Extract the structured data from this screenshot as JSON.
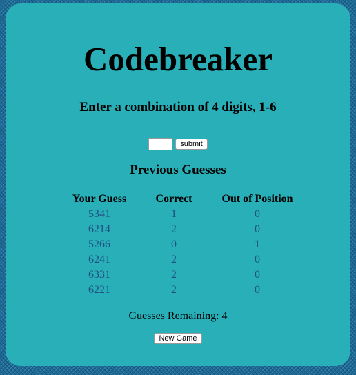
{
  "page": {
    "title": "Codebreaker",
    "instructions": "Enter a combination of 4 digits, 1-6"
  },
  "form": {
    "guess_value": "",
    "submit_label": "submit"
  },
  "history": {
    "heading": "Previous Guesses",
    "columns": [
      "Your Guess",
      "Correct",
      "Out of Position"
    ],
    "rows": [
      [
        "5341",
        "1",
        "0"
      ],
      [
        "6214",
        "2",
        "0"
      ],
      [
        "5266",
        "0",
        "1"
      ],
      [
        "6241",
        "2",
        "0"
      ],
      [
        "6331",
        "2",
        "0"
      ],
      [
        "6221",
        "2",
        "0"
      ]
    ]
  },
  "status": {
    "remaining_label": "Guesses Remaining: 4"
  },
  "actions": {
    "new_game_label": "New Game"
  },
  "colors": {
    "panel": "#29afb8",
    "border_pattern": "#1d6a94",
    "table_values": "#1f4f82"
  }
}
